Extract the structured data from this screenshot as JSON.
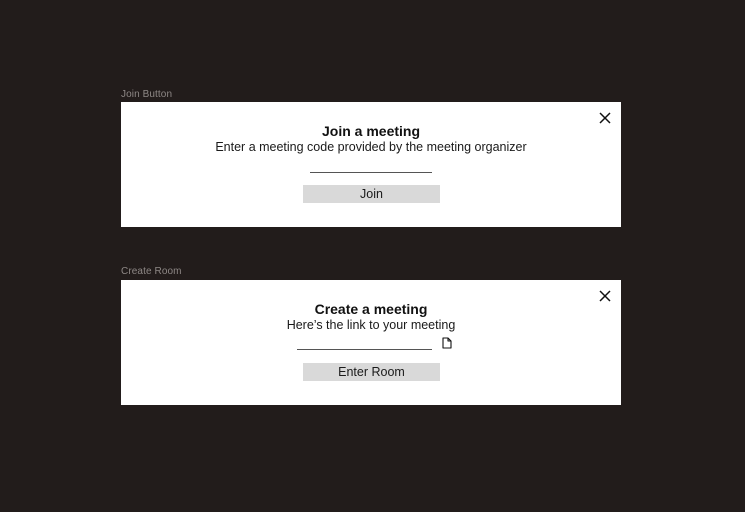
{
  "join_frame": {
    "frame_label": "Join Button",
    "title": "Join a meeting",
    "subtitle": "Enter a meeting code provided by the meeting organizer",
    "code_input_value": "",
    "button_label": "Join",
    "close_icon": "close-icon"
  },
  "create_frame": {
    "frame_label": "Create Room",
    "title": "Create a meeting",
    "subtitle": "Here’s the link to your meeting",
    "link_input_value": "",
    "copy_icon": "document-icon",
    "button_label": "Enter Room",
    "close_icon": "close-icon"
  },
  "colors": {
    "background": "#221c1b",
    "frame": "#ffffff",
    "button": "#d9d9d9",
    "label": "#8e8886"
  }
}
